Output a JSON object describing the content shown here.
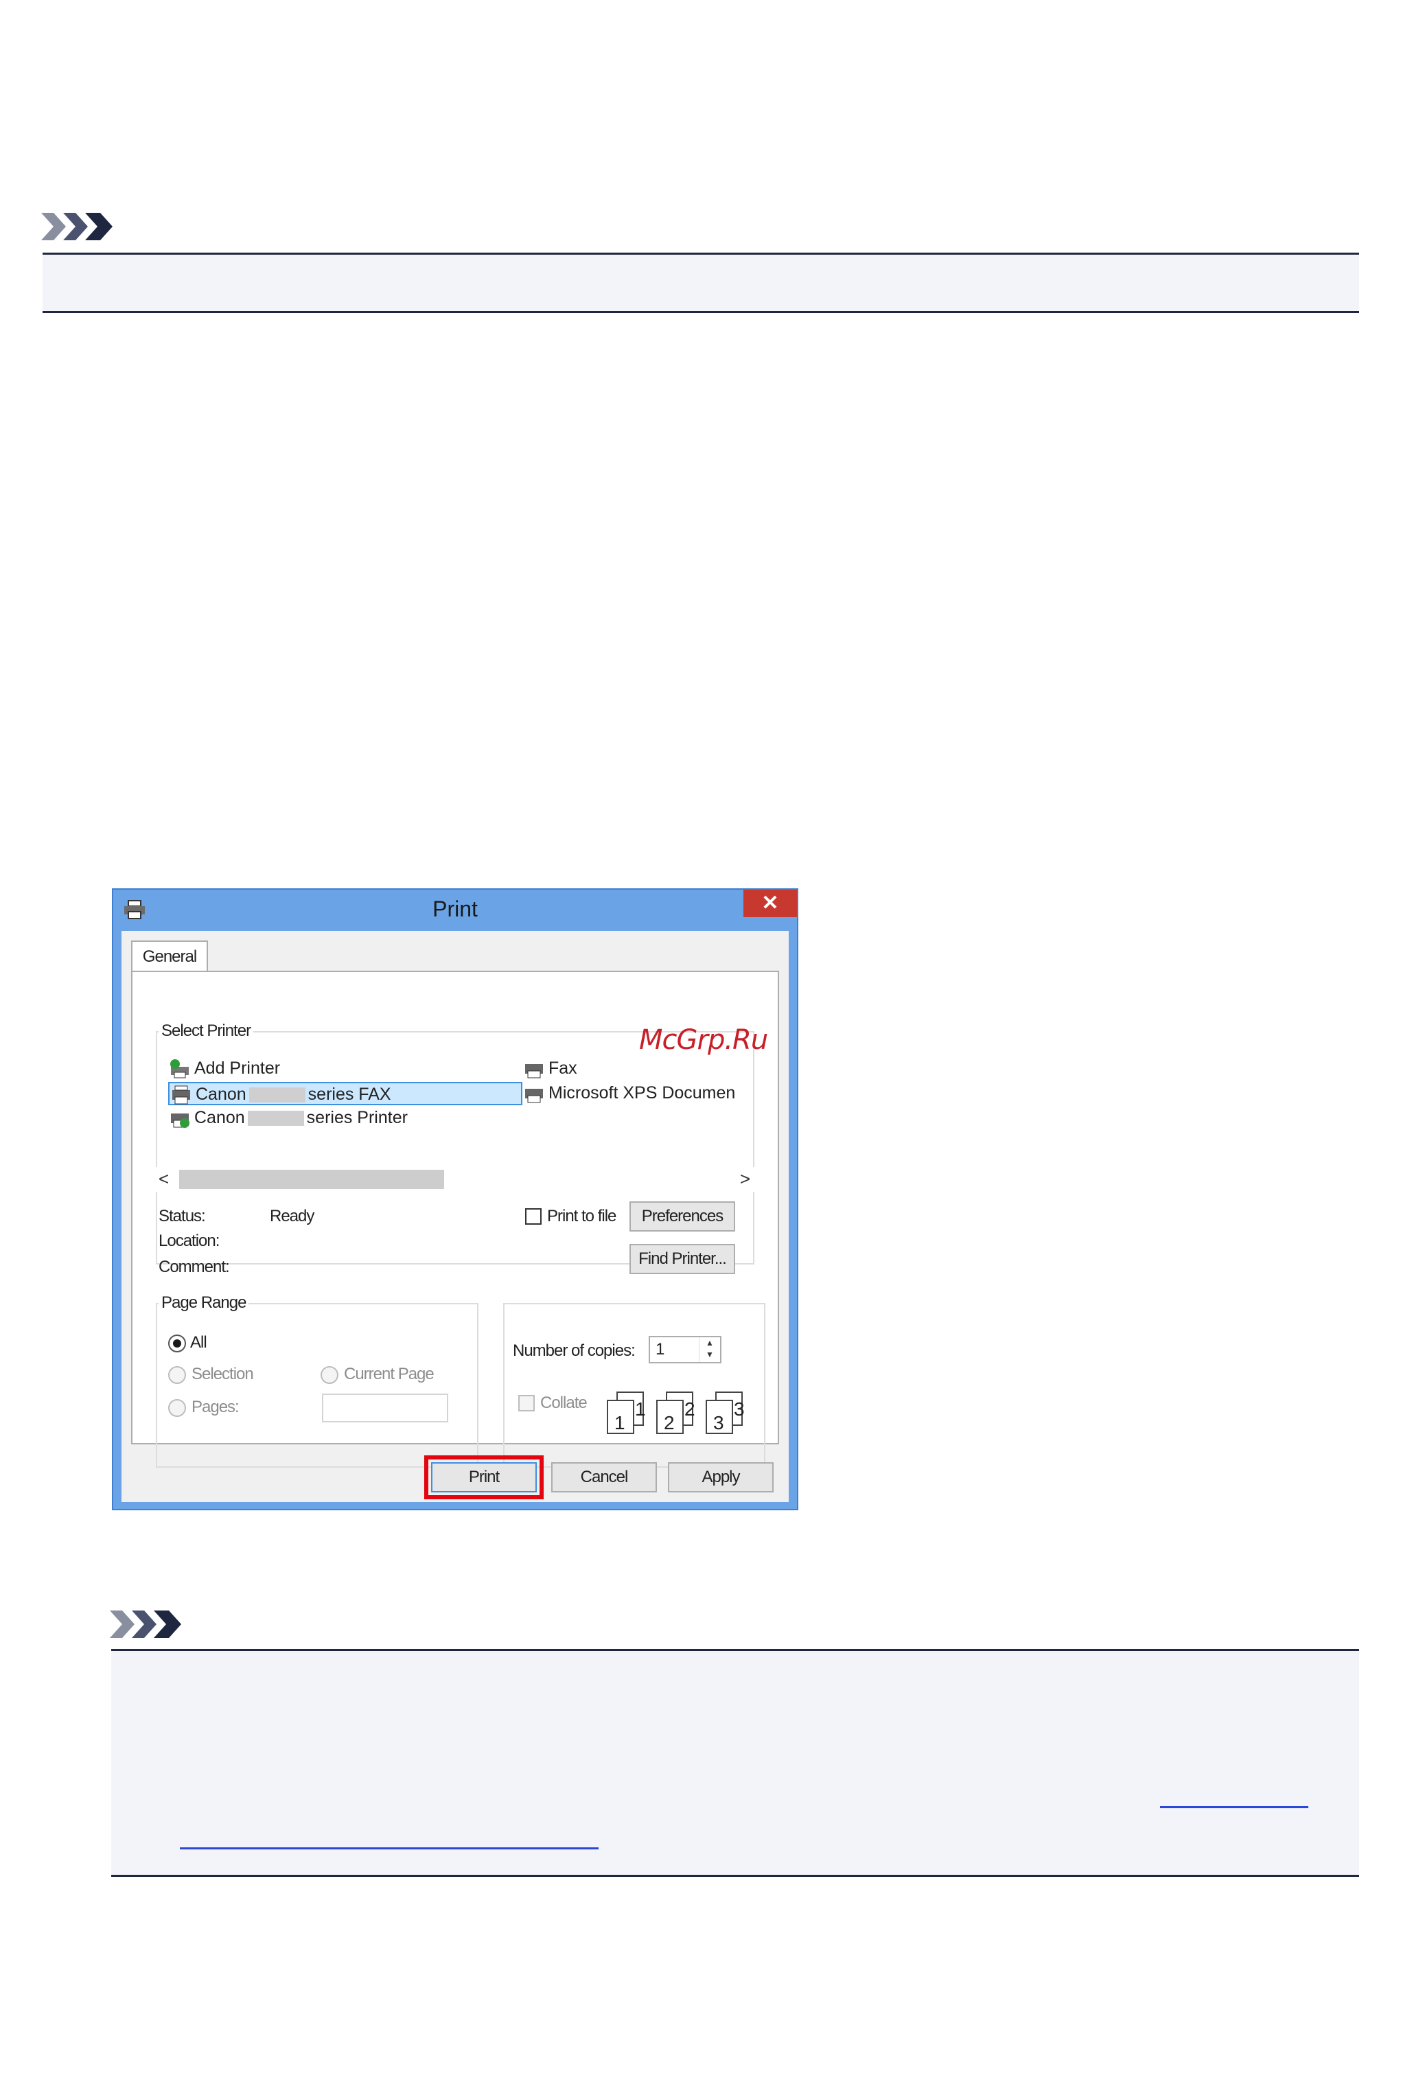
{
  "dialog": {
    "title": "Print",
    "close_label": "✕",
    "tab_general": "General",
    "select_printer": {
      "group_title": "Select Printer",
      "items": [
        {
          "label": "Add Printer",
          "icon": "add-printer-icon"
        },
        {
          "label_prefix": "Canon",
          "label_suffix": "series FAX",
          "icon": "fax-printer-icon",
          "selected": true
        },
        {
          "label_prefix": "Canon",
          "label_suffix": "series Printer",
          "icon": "default-printer-icon"
        },
        {
          "label": "Fax",
          "icon": "fax-icon"
        },
        {
          "label": "Microsoft XPS Documen",
          "icon": "printer-icon"
        }
      ],
      "scroll_left": "<",
      "scroll_right": ">"
    },
    "status_label": "Status:",
    "status_value": "Ready",
    "location_label": "Location:",
    "comment_label": "Comment:",
    "print_to_file_label": "Print to file",
    "preferences_label": "Preferences",
    "find_printer_label": "Find Printer...",
    "page_range": {
      "group_title": "Page Range",
      "all_label": "All",
      "selection_label": "Selection",
      "current_page_label": "Current Page",
      "pages_label": "Pages:"
    },
    "copies": {
      "label": "Number of copies:",
      "value": "1",
      "collate_label": "Collate",
      "collate_numbers": [
        "1",
        "1",
        "2",
        "2",
        "3",
        "3"
      ]
    },
    "buttons": {
      "print": "Print",
      "cancel": "Cancel",
      "apply": "Apply"
    }
  },
  "watermark": "McGrp.Ru",
  "colors": {
    "title_bar": "#6ba4e6",
    "close": "#c7392f",
    "highlight": "#e3050f",
    "selection": "#cce8ff",
    "note_marker": "#1f2740",
    "note_bg": "#f3f4f9",
    "link": "#2a47d8"
  }
}
